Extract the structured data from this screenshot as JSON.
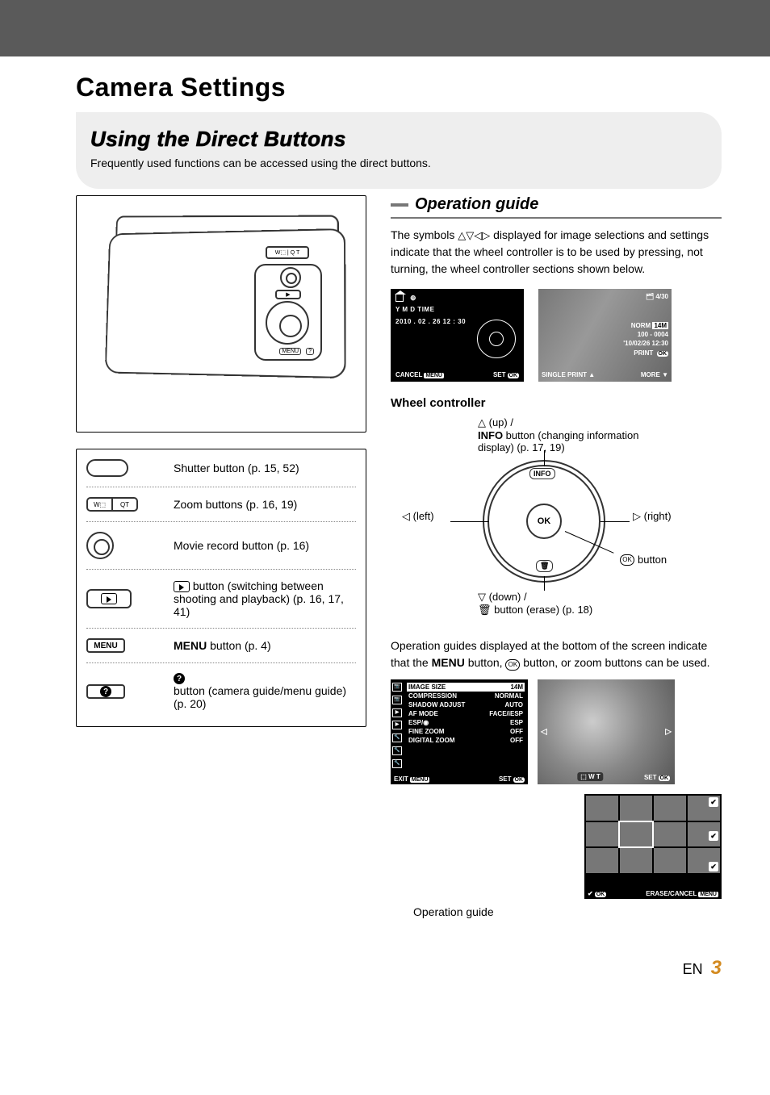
{
  "header": {
    "title": "Camera Settings"
  },
  "section": {
    "subtitle": "Using the Direct Buttons",
    "desc": "Frequently used functions can be accessed using the direct buttons."
  },
  "buttons_list": {
    "shutter": "Shutter button (p. 15, 52)",
    "zoom": "Zoom buttons (p. 16, 19)",
    "movie": "Movie record button (p. 16)",
    "playback": " button (switching between shooting and playback) (p. 16, 17, 41)",
    "menu_word": "MENU",
    "menu": " button (p. 4)",
    "help": " button (camera guide/menu guide) (p. 20)",
    "zoom_w": "W",
    "zoom_t": "T"
  },
  "op_guide": {
    "heading": "Operation guide",
    "intro_a": "The symbols ",
    "intro_arrows": "△▽◁▷",
    "intro_b": " displayed for image selections and settings indicate that the wheel controller is to be used by pressing, not turning, the wheel controller sections shown below.",
    "wheel_heading": "Wheel controller",
    "up_a": "△ (up) /",
    "up_b_bold": "INFO",
    "up_b_rest": " button (changing information display) (p. 17, 19)",
    "left": "◁ (left)",
    "right": "▷ (right)",
    "down_a": "▽ (down) /",
    "down_b": "🗑 button (erase) (p. 18)",
    "ok_label": " button",
    "bottom_a": "Operation guides displayed at the bottom of the screen indicate that the ",
    "bottom_menu": "MENU",
    "bottom_b": " button, ",
    "bottom_c": " button, or zoom buttons can be used.",
    "caption": "Operation guide",
    "info_chip": "INFO",
    "ok_chip": "OK"
  },
  "screen_date": {
    "ymd_head": "Y   M   D   TIME",
    "date": "2010 . 02 . 26  12 : 30",
    "cancel": "CANCEL",
    "set": "SET",
    "menu_chip": "MENU",
    "ok_chip": "OK"
  },
  "screen_play": {
    "counter": "4/30",
    "norm": "NORM",
    "size": "14M",
    "file": "100 - 0004",
    "dt": "'10/02/26 12:30",
    "print": "PRINT",
    "single": "SINGLE PRINT",
    "more": "MORE",
    "ok_chip": "OK"
  },
  "menu_screen": {
    "rows": [
      {
        "k": "IMAGE SIZE",
        "v": "14M"
      },
      {
        "k": "COMPRESSION",
        "v": "NORMAL"
      },
      {
        "k": "SHADOW ADJUST",
        "v": "AUTO"
      },
      {
        "k": "AF MODE",
        "v": "FACE/iESP"
      },
      {
        "k": "ESP/◉",
        "v": "ESP"
      },
      {
        "k": "FINE ZOOM",
        "v": "OFF"
      },
      {
        "k": "DIGITAL ZOOM",
        "v": "OFF"
      }
    ],
    "exit": "EXIT",
    "set": "SET",
    "menu_chip": "MENU",
    "ok_chip": "OK"
  },
  "rose_screen": {
    "zoom": "W T",
    "set": "SET",
    "ok_chip": "OK"
  },
  "thumbs_screen": {
    "ok_chip": "OK",
    "erase": "ERASE/CANCEL",
    "menu_chip": "MENU"
  },
  "footer": {
    "lang": "EN",
    "page": "3"
  }
}
